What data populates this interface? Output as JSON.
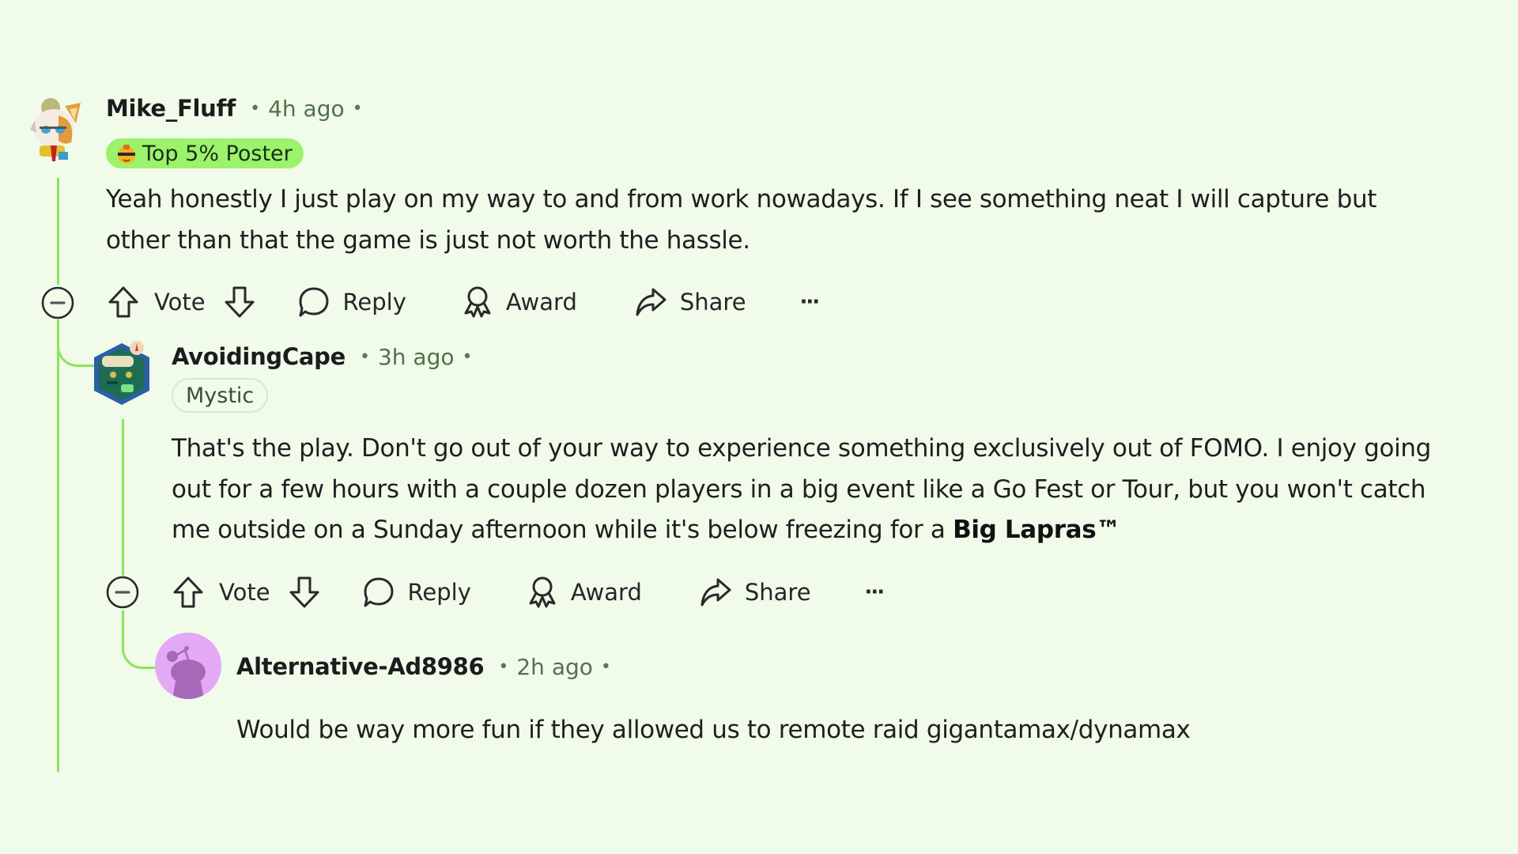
{
  "comments": [
    {
      "username": "Mike_Fluff",
      "time": "4h ago",
      "separator": "•",
      "flair": "Top 5% Poster",
      "flair_color": "#9cf26b",
      "body_lines": [
        "Yeah honestly I just play on my way to and from work nowadays. If I see something neat I will capture but",
        "other than that the game is just not worth the hassle."
      ],
      "actions": {
        "vote": "Vote",
        "reply": "Reply",
        "award": "Award",
        "share": "Share",
        "more": "···"
      }
    },
    {
      "username": "AvoidingCape",
      "time": "3h ago",
      "separator": "•",
      "flair": "Mystic",
      "body_lines": [
        "That's the play. Don't go out of your way to experience something exclusively out of FOMO. I enjoy going",
        "out for a few hours with a couple dozen players in a big event like a Go Fest or Tour, but you won't catch",
        "me outside on a Sunday afternoon while it's below freezing for a "
      ],
      "body_bold": "Big Lapras™",
      "actions": {
        "vote": "Vote",
        "reply": "Reply",
        "award": "Award",
        "share": "Share",
        "more": "···"
      }
    },
    {
      "username": "Alternative-Ad8986",
      "time": "2h ago",
      "separator": "•",
      "body_lines": [
        "Would be way more fun if they allowed us to remote raid gigantamax/dynamax"
      ]
    }
  ],
  "colors": {
    "background": "#f0fbea",
    "thread_line": "#8fe35a",
    "default_avatar": "#e4a9f5"
  }
}
